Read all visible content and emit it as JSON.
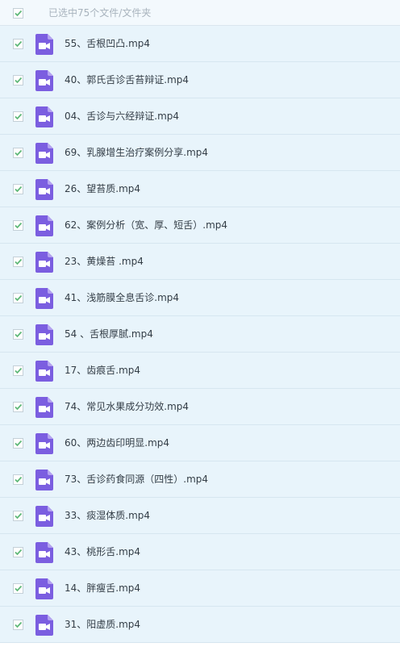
{
  "header": {
    "selection_label": "已选中75个文件/文件夹"
  },
  "colors": {
    "check": "#5fb878",
    "video_icon": "#7b5ee0",
    "row_bg": "#e8f4fb"
  },
  "file_icon_name": "video-file-icon",
  "files": [
    {
      "name": "55、舌根凹凸.mp4",
      "checked": true
    },
    {
      "name": "40、郭氏舌诊舌苔辩证.mp4",
      "checked": true
    },
    {
      "name": "04、舌诊与六经辩证.mp4",
      "checked": true
    },
    {
      "name": "69、乳腺增生治疗案例分享.mp4",
      "checked": true
    },
    {
      "name": "26、望苔质.mp4",
      "checked": true
    },
    {
      "name": "62、案例分析（宽、厚、短舌）.mp4",
      "checked": true
    },
    {
      "name": "23、黄燥苔 .mp4",
      "checked": true
    },
    {
      "name": "41、浅筋膜全息舌诊.mp4",
      "checked": true
    },
    {
      "name": "54 、舌根厚腻.mp4",
      "checked": true
    },
    {
      "name": "17、齿痕舌.mp4",
      "checked": true
    },
    {
      "name": "74、常见水果成分功效.mp4",
      "checked": true
    },
    {
      "name": "60、两边齿印明显.mp4",
      "checked": true
    },
    {
      "name": "73、舌诊药食同源（四性）.mp4",
      "checked": true
    },
    {
      "name": "33、痰湿体质.mp4",
      "checked": true
    },
    {
      "name": "43、桃形舌.mp4",
      "checked": true
    },
    {
      "name": "14、胖瘦舌.mp4",
      "checked": true
    },
    {
      "name": "31、阳虚质.mp4",
      "checked": true
    }
  ]
}
